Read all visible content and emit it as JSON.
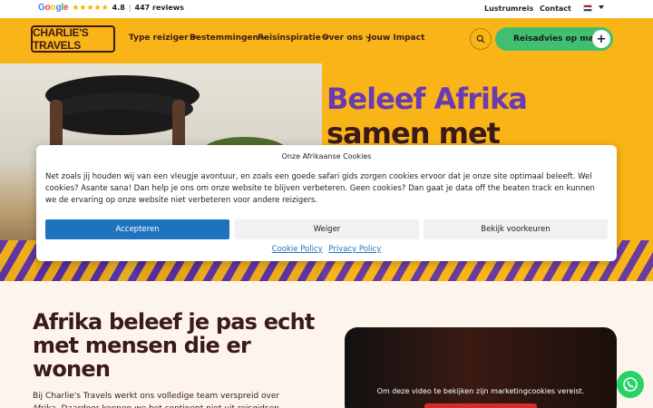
{
  "topbar": {
    "google_word": [
      "G",
      "o",
      "o",
      "g",
      "l",
      "e"
    ],
    "stars": "★★★★★",
    "rating": "4.8",
    "separator": "|",
    "reviews": "447 reviews",
    "links": [
      "Lustrumreis",
      "Contact"
    ],
    "language_flag": "nl-flag"
  },
  "nav": {
    "logo": "CHARLIE'S TRAVELS",
    "items": [
      "Type reiziger",
      "Bestemmingen",
      "Reisinspiratie",
      "Over ons",
      "Jouw Impact"
    ],
    "search_icon": "search-icon",
    "cta_label": "Reisadvies op maat",
    "cta_icon": "+"
  },
  "hero": {
    "title_line1": "Beleef Afrika",
    "title_line2": "samen met"
  },
  "cookie_modal": {
    "title": "Onze Afrikaanse Cookies",
    "text": "Net zoals jij houden wij van een vleugje avontuur, en zoals een goede safari gids zorgen cookies ervoor dat je onze site optimaal beleeft. Wel cookies? Asante sana! Dan help je ons om onze website te blijven verbeteren. Geen cookies? Dan gaat je data off the beaten track en kunnen we de ervaring op onze website niet verbeteren voor andere reizigers.",
    "accept": "Accepteren",
    "deny": "Weiger",
    "preferences": "Bekijk voorkeuren",
    "cookie_policy": "Cookie Policy",
    "privacy_policy": "Privacy Policy"
  },
  "section": {
    "title": "Afrika beleef je pas echt met mensen die er wonen",
    "text": "Bij Charlie's Travels werkt ons volledige team verspreid over Afrika. Daardoor kennen we het continent niet uit reisgidsen, maar uit het",
    "video_message": "Om deze video te bekijken zijn marketingcookies vereist."
  },
  "colors": {
    "brand_yellow": "#f9b517",
    "brand_purple": "#6a3ab2",
    "brand_brown": "#3b1a1a",
    "cta_green": "#3fbf6f",
    "accept_blue": "#1e73be"
  }
}
